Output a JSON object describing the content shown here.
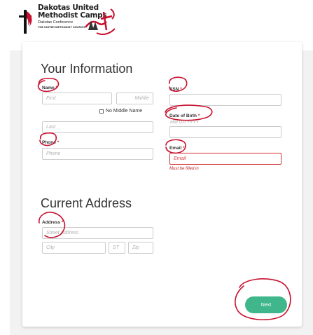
{
  "header": {
    "logo_line1": "Dakotas United",
    "logo_line2": "Methodist Camps",
    "logo_sub1": "Dakotas Conference",
    "logo_sub2": "THE UNITED METHODIST CHURCH"
  },
  "your_information": {
    "title": "Your Information",
    "name_label": "Name",
    "required_mark": "*",
    "first_placeholder": "First",
    "middle_placeholder": "Middle",
    "no_middle_name_label": "No Middle Name",
    "last_placeholder": "Last",
    "phone_label": "Phone",
    "phone_placeholder": "Phone",
    "ssn_label": "SSN",
    "ssn_value": "",
    "dob_label": "Date of Birth",
    "dob_placeholder": "MM DD YYYY",
    "email_label": "Email",
    "email_placeholder": "Email",
    "email_error": "Must be filled in"
  },
  "current_address": {
    "title": "Current Address",
    "address_label": "Address",
    "street_placeholder": "Street Address",
    "city_placeholder": "City",
    "state_placeholder": "ST",
    "zip_placeholder": "Zip"
  },
  "actions": {
    "next_label": "Next"
  },
  "colors": {
    "accent": "#3fb68b",
    "error": "#d32f2f",
    "annotation": "#c8102e"
  }
}
